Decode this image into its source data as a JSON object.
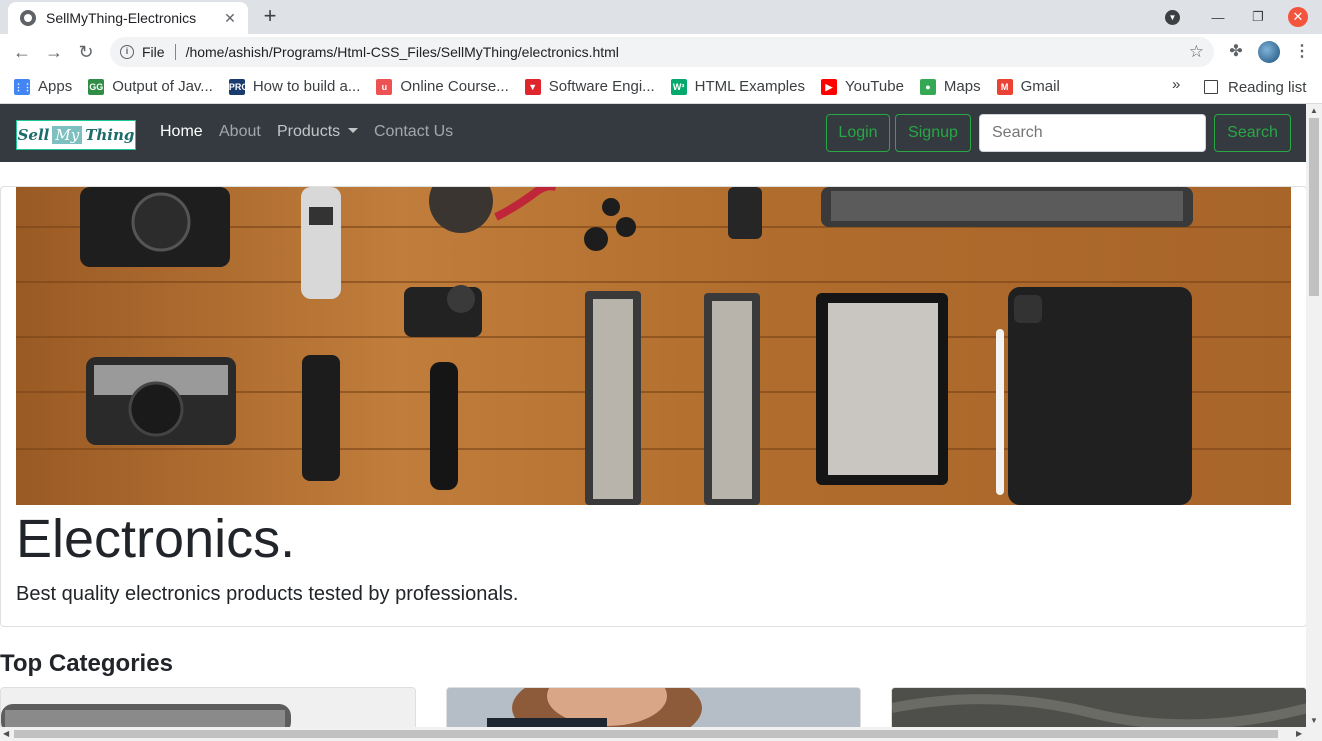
{
  "browser": {
    "tab_title": "SellMyThing-Electronics",
    "new_tab_symbol": "+",
    "url_scheme_label": "File",
    "url": "/home/ashish/Programs/Html-CSS_Files/SellMyThing/electronics.html",
    "bookmarks": [
      {
        "label": "Apps",
        "icon": "apps-grid-icon",
        "color": "#4285f4"
      },
      {
        "label": "Output of Jav...",
        "icon": "gfg-icon",
        "color": "#2f8d46"
      },
      {
        "label": "How to build a...",
        "icon": "ipro-icon",
        "color": "#1a3b6e"
      },
      {
        "label": "Online Course...",
        "icon": "udemy-icon",
        "color": "#ec5252"
      },
      {
        "label": "Software Engi...",
        "icon": "triangle-logo-icon",
        "color": "#e0262d"
      },
      {
        "label": "HTML Examples",
        "icon": "w3-icon",
        "color": "#04aa6d"
      },
      {
        "label": "YouTube",
        "icon": "youtube-icon",
        "color": "#ff0000"
      },
      {
        "label": "Maps",
        "icon": "maps-pin-icon",
        "color": "#34a853"
      },
      {
        "label": "Gmail",
        "icon": "gmail-icon",
        "color": "#ea4335"
      }
    ],
    "more_bookmarks": "»",
    "reading_list": "Reading list"
  },
  "navbar": {
    "brand_part1": "Sell",
    "brand_part2": "My",
    "brand_part3": "Thing",
    "links": [
      "Home",
      "About",
      "Products",
      "Contact Us"
    ],
    "login": "Login",
    "signup": "Signup",
    "search_placeholder": "Search",
    "search_button": "Search"
  },
  "hero": {
    "title": "Electronics.",
    "lead": "Best quality electronics products tested by professionals."
  },
  "section": {
    "top_categories": "Top Categories"
  },
  "colors": {
    "navbar_bg": "#343a40",
    "success": "#28a745",
    "wood": "#b5702f"
  }
}
